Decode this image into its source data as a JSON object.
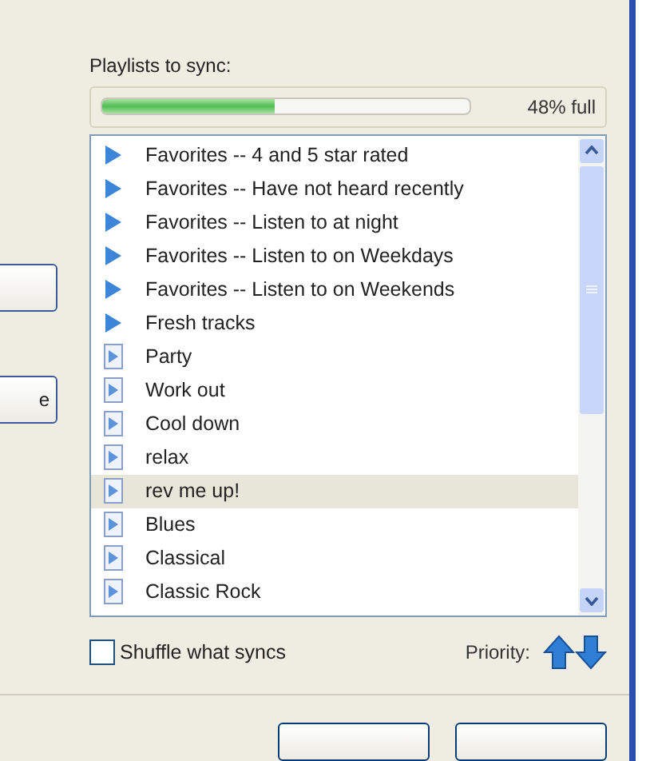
{
  "heading": "Playlists to sync:",
  "capacity": {
    "level": 0.47,
    "reading": "48% full"
  },
  "playlists": [
    {
      "name": "Favorites -- 4 and 5 star rated",
      "kind": "auto",
      "selected": false
    },
    {
      "name": "Favorites -- Have not heard recently",
      "kind": "auto",
      "selected": false
    },
    {
      "name": "Favorites -- Listen to at night",
      "kind": "auto",
      "selected": false
    },
    {
      "name": "Favorites -- Listen to on Weekdays",
      "kind": "auto",
      "selected": false
    },
    {
      "name": "Favorites -- Listen to on Weekends",
      "kind": "auto",
      "selected": false
    },
    {
      "name": "Fresh tracks",
      "kind": "auto",
      "selected": false
    },
    {
      "name": "Party",
      "kind": "regular",
      "selected": false
    },
    {
      "name": "Work out",
      "kind": "regular",
      "selected": false
    },
    {
      "name": "Cool down",
      "kind": "regular",
      "selected": false
    },
    {
      "name": "relax",
      "kind": "regular",
      "selected": false
    },
    {
      "name": "rev me up!",
      "kind": "regular",
      "selected": true
    },
    {
      "name": "Blues",
      "kind": "regular",
      "selected": false
    },
    {
      "name": "Classical",
      "kind": "regular",
      "selected": false
    },
    {
      "name": "Classic Rock",
      "kind": "regular",
      "selected": false
    }
  ],
  "shuffle": {
    "label": "Shuffle what syncs",
    "checked": false
  },
  "priority": {
    "label": "Priority:"
  },
  "side_button_text": "e"
}
